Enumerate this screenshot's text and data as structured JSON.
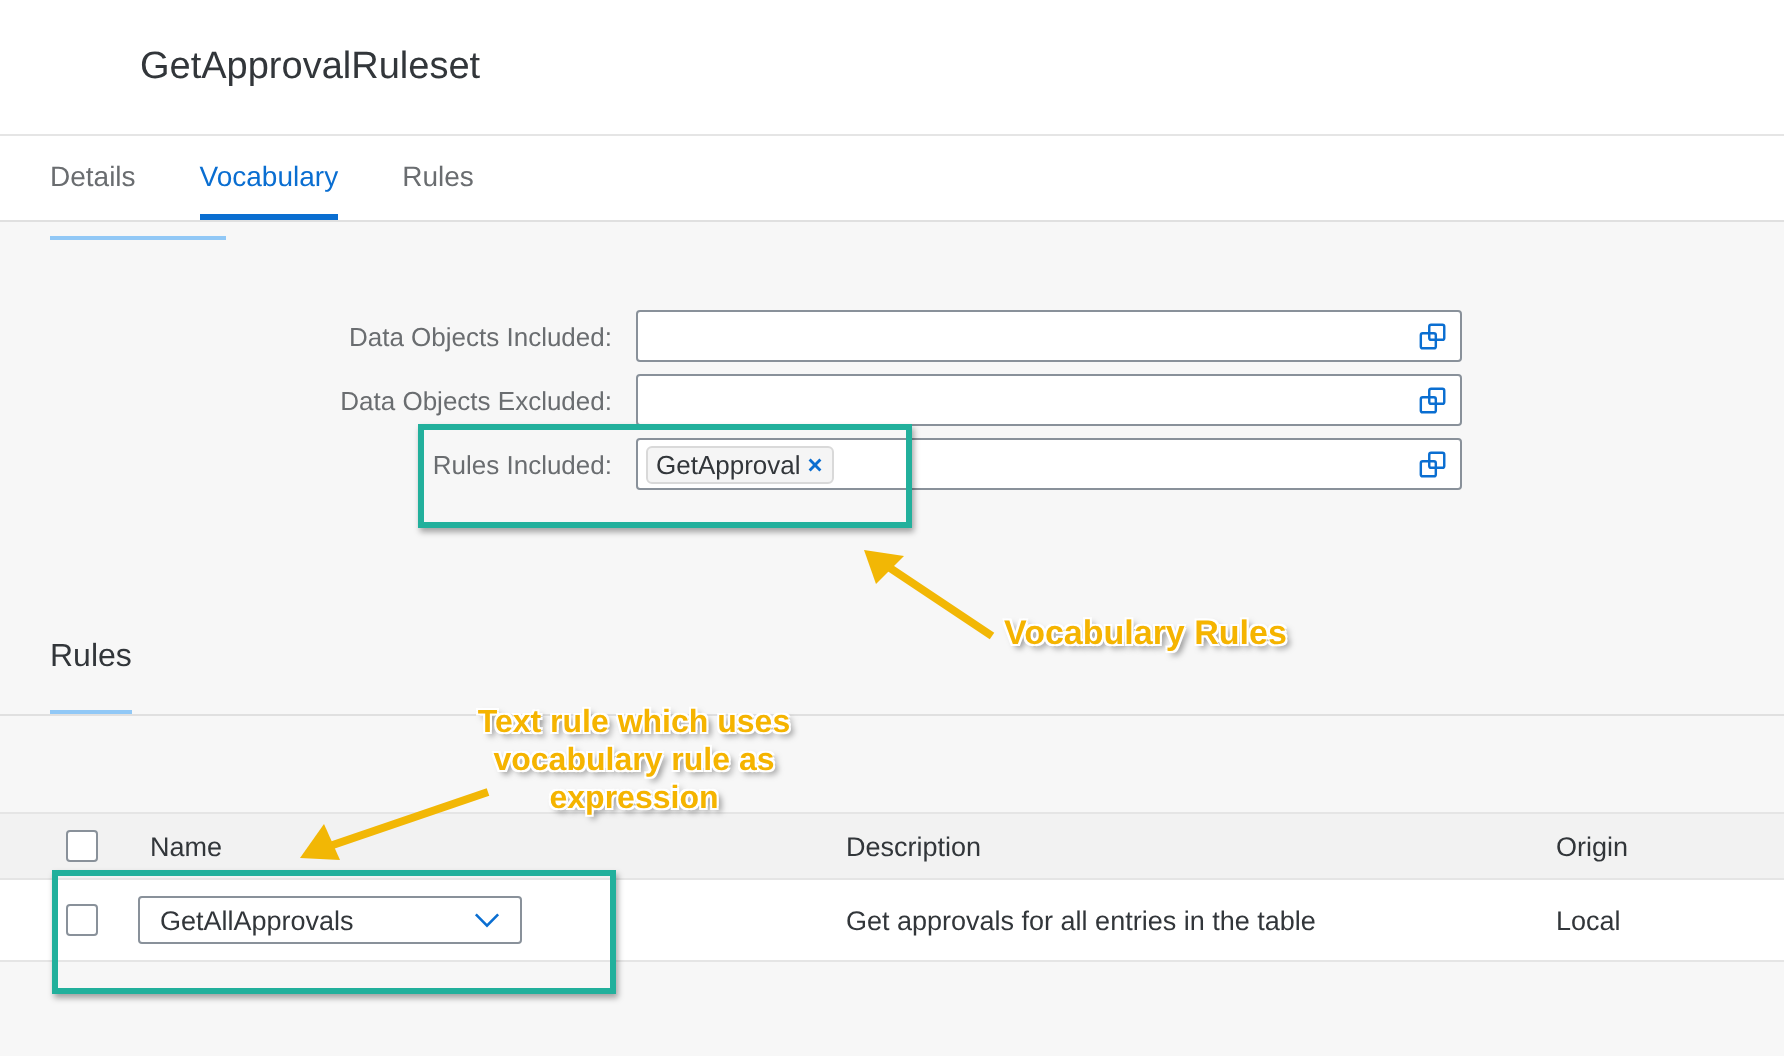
{
  "page_title": "GetApprovalRuleset",
  "tabs": [
    {
      "label": "Details",
      "selected": false
    },
    {
      "label": "Vocabulary",
      "selected": true
    },
    {
      "label": "Rules",
      "selected": false
    }
  ],
  "vocabulary_form": [
    {
      "label": "Data Objects Included:"
    },
    {
      "label": "Data Objects Excluded:"
    },
    {
      "label": "Rules Included:",
      "tokens": [
        "GetApproval"
      ]
    }
  ],
  "rules_section": {
    "title": "Rules",
    "select_all_checked": false,
    "columns": [
      "Name",
      "Description",
      "Origin"
    ],
    "rows": [
      {
        "checked": false,
        "name": "GetAllApprovals",
        "description": "Get approvals for all entries in the table",
        "origin": "Local"
      }
    ]
  },
  "annotations": [
    {
      "text": "Vocabulary Rules"
    },
    {
      "text": "Text rule which uses vocabulary rule as expression"
    }
  ]
}
